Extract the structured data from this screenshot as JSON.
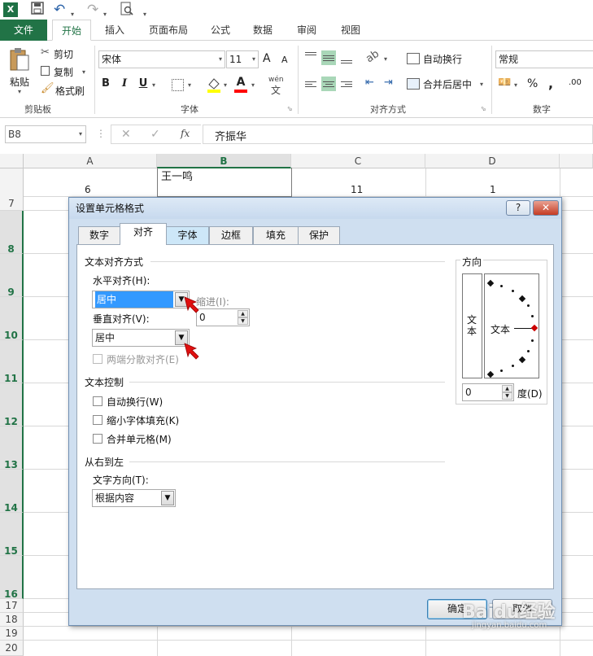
{
  "qat": {
    "logo": "X",
    "undo": "↶",
    "redo": "↷",
    "more": "▾"
  },
  "tabs": [
    "文件",
    "开始",
    "插入",
    "页面布局",
    "公式",
    "数据",
    "审阅",
    "视图"
  ],
  "clipboard": {
    "paste": "粘贴",
    "cut": "剪切",
    "copy": "复制",
    "format_painter": "格式刷",
    "group": "剪贴板"
  },
  "font": {
    "name": "宋体",
    "size": "11",
    "grow": "A",
    "shrink": "A",
    "bold": "B",
    "italic": "I",
    "underline": "U",
    "fill_color": "#ffff00",
    "font_color": "#ff0000",
    "phonetic": "wén",
    "group": "字体"
  },
  "alignment": {
    "wrap": "自动换行",
    "merge": "合并后居中",
    "group": "对齐方式"
  },
  "number": {
    "format": "常规",
    "percent": "%",
    "comma": ",",
    "group": "数字"
  },
  "formula_bar": {
    "name_box": "B8",
    "cancel": "✕",
    "enter": "✓",
    "fx": "fx",
    "content": "齐振华"
  },
  "sheet": {
    "columns": [
      "A",
      "B",
      "C",
      "D"
    ],
    "rows": [
      "7",
      "8",
      "9",
      "10",
      "11",
      "12",
      "13",
      "14",
      "15",
      "16",
      "17",
      "18",
      "19",
      "20"
    ],
    "row6": {
      "a": "6",
      "b": "王一鸣",
      "c": "11",
      "d": "1"
    }
  },
  "dialog": {
    "title": "设置单元格格式",
    "help": "?",
    "close": "✕",
    "tabs": [
      "数字",
      "对齐",
      "字体",
      "边框",
      "填充",
      "保护"
    ],
    "text_alignment": "文本对齐方式",
    "horizontal_label": "水平对齐(H):",
    "horizontal_value": "居中",
    "indent_label": "缩进(I):",
    "indent_value": "0",
    "vertical_label": "垂直对齐(V):",
    "vertical_value": "居中",
    "justify_distributed": "两端分散对齐(E)",
    "text_control": "文本控制",
    "wrap_text": "自动换行(W)",
    "shrink_to_fit": "缩小字体填充(K)",
    "merge_cells": "合并单元格(M)",
    "rtl": "从右到左",
    "text_direction_label": "文字方向(T):",
    "text_direction_value": "根据内容",
    "orientation": "方向",
    "vertical_text": "文本",
    "orientation_text": "文本",
    "degrees_value": "0",
    "degrees_label": "度(D)",
    "ok": "确定",
    "cancel": "取消"
  },
  "watermark": "Baidu经验",
  "watermark_url": "jingyan.baidu.com"
}
